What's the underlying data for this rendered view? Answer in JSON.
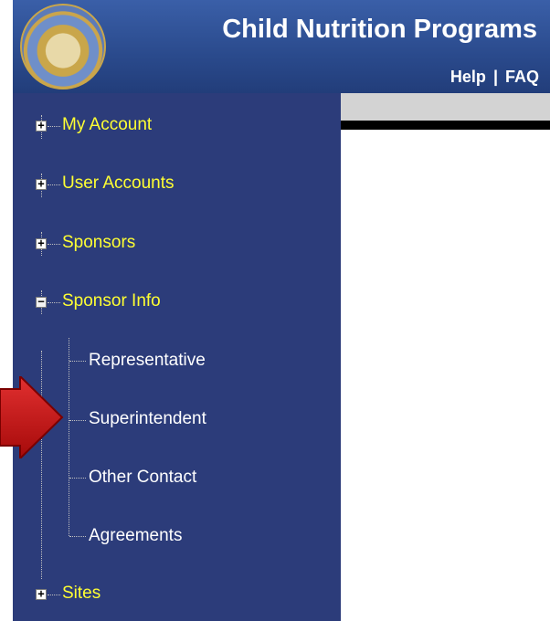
{
  "header": {
    "title": "Child Nutrition Programs",
    "links": [
      {
        "label": "Help"
      },
      {
        "label": "FAQ"
      }
    ],
    "separator": "|"
  },
  "sidebar": {
    "items": [
      {
        "label": "My Account",
        "state": "collapsed"
      },
      {
        "label": "User Accounts",
        "state": "collapsed"
      },
      {
        "label": "Sponsors",
        "state": "collapsed"
      },
      {
        "label": "Sponsor Info",
        "state": "expanded",
        "children": [
          {
            "label": "Representative"
          },
          {
            "label": "Superintendent"
          },
          {
            "label": "Other Contact"
          },
          {
            "label": "Agreements"
          }
        ]
      },
      {
        "label": "Sites",
        "state": "collapsed"
      }
    ]
  },
  "annotation": {
    "arrow_color": "#cc1111",
    "points_to": "Superintendent"
  },
  "colors": {
    "header_bg": "#2a4a8c",
    "sidebar_bg": "#2c3c7a",
    "top_level_text": "#ffff33",
    "child_text": "#ffffff"
  }
}
